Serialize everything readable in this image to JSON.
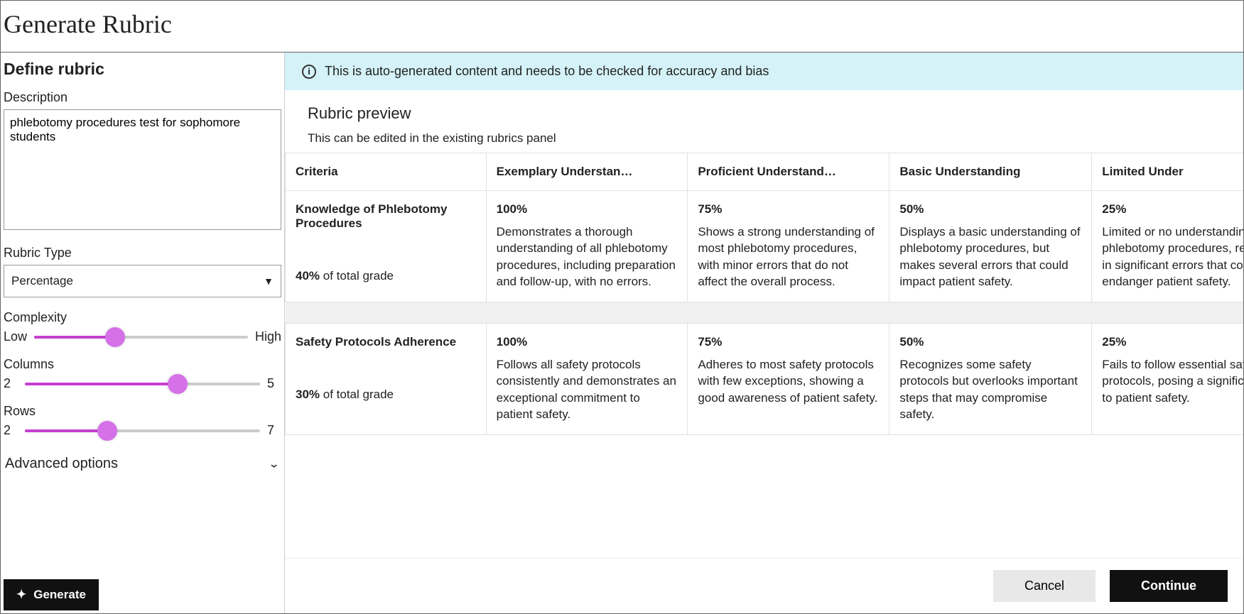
{
  "page_title": "Generate Rubric",
  "sidebar": {
    "heading": "Define rubric",
    "description": {
      "label": "Description",
      "value": "phlebotomy procedures test for sophomore students"
    },
    "rubric_type": {
      "label": "Rubric Type",
      "value": "Percentage"
    },
    "complexity": {
      "label": "Complexity",
      "low": "Low",
      "high": "High",
      "pct": 38
    },
    "columns": {
      "label": "Columns",
      "min": "2",
      "max": "5",
      "pct": 65
    },
    "rows": {
      "label": "Rows",
      "min": "2",
      "max": "7",
      "pct": 35
    },
    "advanced": "Advanced options",
    "generate": "Generate"
  },
  "banner": "This is auto-generated content and needs to be checked for accuracy and bias",
  "preview": {
    "title": "Rubric preview",
    "subtitle": "This can be edited in the existing rubrics panel"
  },
  "table": {
    "headers": [
      "Criteria",
      "Exemplary Understan…",
      "Proficient Understand…",
      "Basic Understanding",
      "Limited Under"
    ],
    "rows": [
      {
        "criteria": "Knowledge of Phlebotomy Procedures",
        "weight": "40%",
        "weight_suffix": " of total grade",
        "cells": [
          {
            "pct": "100%",
            "desc": "Demonstrates a thorough understanding of all phlebotomy procedures, including preparation and follow-up, with no errors."
          },
          {
            "pct": "75%",
            "desc": "Shows a strong understanding of most phlebotomy procedures, with minor errors that do not affect the overall process."
          },
          {
            "pct": "50%",
            "desc": "Displays a basic understanding of phlebotomy procedures, but makes several errors that could impact patient safety."
          },
          {
            "pct": "25%",
            "desc": "Limited or no understanding of phlebotomy procedures, resulting in significant errors that could endanger patient safety."
          }
        ]
      },
      {
        "criteria": "Safety Protocols Adherence",
        "weight": "30%",
        "weight_suffix": " of total grade",
        "cells": [
          {
            "pct": "100%",
            "desc": "Follows all safety protocols consistently and demonstrates an exceptional commitment to patient safety."
          },
          {
            "pct": "75%",
            "desc": "Adheres to most safety protocols with few exceptions, showing a good awareness of patient safety."
          },
          {
            "pct": "50%",
            "desc": "Recognizes some safety protocols but overlooks important steps that may compromise safety."
          },
          {
            "pct": "25%",
            "desc": "Fails to follow essential safety protocols, posing a significant risk to patient safety."
          }
        ]
      }
    ]
  },
  "footer": {
    "cancel": "Cancel",
    "continue": "Continue"
  }
}
